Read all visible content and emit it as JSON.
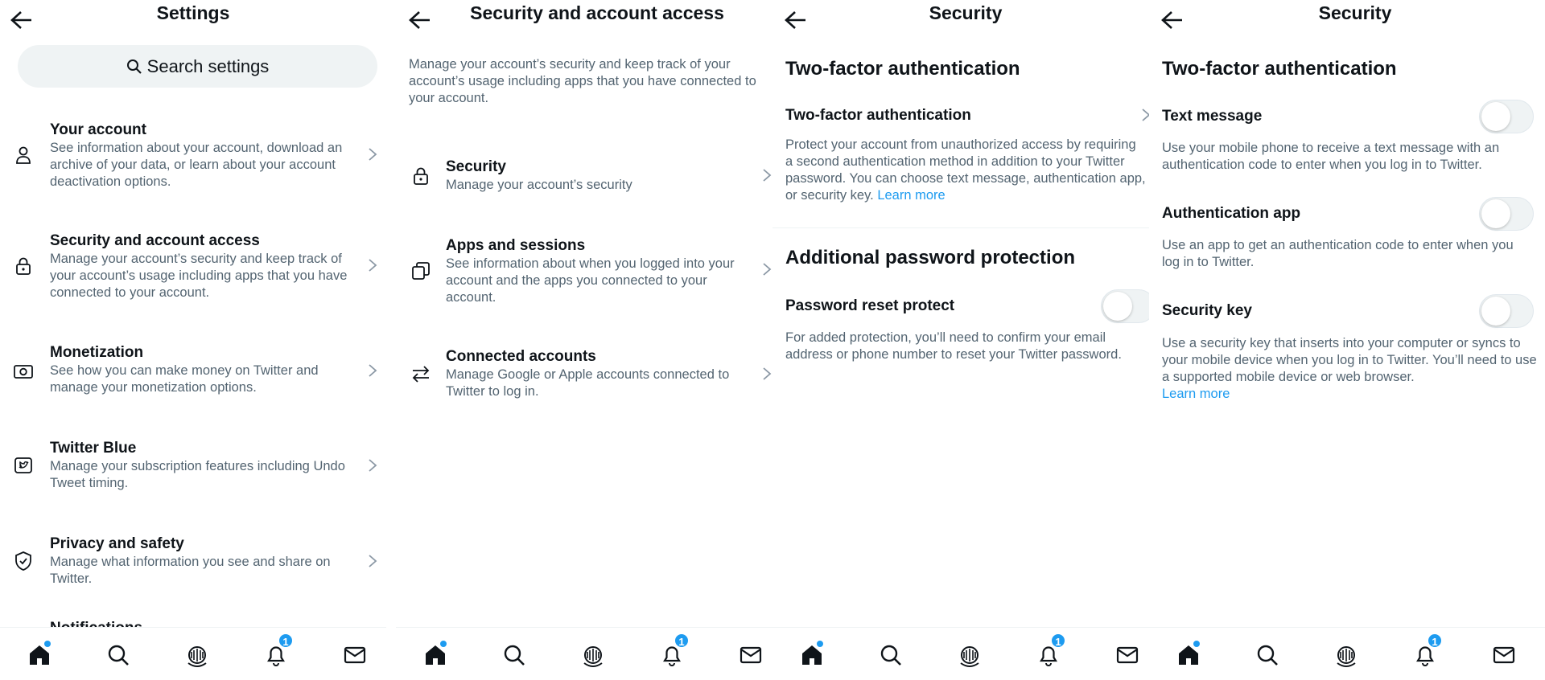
{
  "settings": {
    "title": "Settings",
    "search_placeholder": "Search settings",
    "items": [
      {
        "label": "Your account",
        "desc": "See information about your account, download an archive of your data, or learn about your account deactivation options."
      },
      {
        "label": "Security and account access",
        "desc": "Manage your account’s security and keep track of your account’s usage including apps that you have connected to your account."
      },
      {
        "label": "Monetization",
        "desc": "See how you can make money on Twitter and manage your monetization options."
      },
      {
        "label": "Twitter Blue",
        "desc": "Manage your subscription features including Undo Tweet timing."
      },
      {
        "label": "Privacy and safety",
        "desc": "Manage what information you see and share on Twitter."
      },
      {
        "label": "Notifications",
        "desc": ""
      }
    ]
  },
  "security_access": {
    "title": "Security and account access",
    "intro": "Manage your account’s security and keep track of your account’s usage including apps that you have connected to your account.",
    "items": [
      {
        "label": "Security",
        "desc": "Manage your account’s security"
      },
      {
        "label": "Apps and sessions",
        "desc": "See information about when you logged into your account and the apps you connected to your account."
      },
      {
        "label": "Connected accounts",
        "desc": "Manage Google or Apple accounts connected to Twitter to log in."
      }
    ]
  },
  "security": {
    "title": "Security",
    "tfa_section": "Two-factor authentication",
    "tfa_row": "Two-factor authentication",
    "tfa_desc": "Protect your account from unauthorized access by requiring a second authentication method in addition to your Twitter password. You can choose text message, authentication app, or security key.",
    "learn_more": "Learn more",
    "addl_section": "Additional password protection",
    "reset_row": "Password reset protect",
    "reset_desc": "For added protection, you’ll need to confirm your email address or phone number to reset your Twitter password."
  },
  "security_tfa": {
    "title": "Security",
    "section": "Two-factor authentication",
    "options": [
      {
        "label": "Text message",
        "desc": "Use your mobile phone to receive a text message with an authentication code to enter when you log in to Twitter."
      },
      {
        "label": "Authentication app",
        "desc": "Use an app to get an authentication code to enter when you log in to Twitter."
      },
      {
        "label": "Security key",
        "desc": "Use a security key that inserts into your computer or syncs to your mobile device when you log in to Twitter. You’ll need to use a supported mobile device or web browser."
      }
    ],
    "learn_more": "Learn more"
  },
  "tabbar": {
    "icons": [
      "home-icon",
      "search-icon",
      "spaces-icon",
      "notifications-icon",
      "messages-icon"
    ],
    "notification_count": "1"
  },
  "colors": {
    "accent": "#1d9bf0",
    "text": "#0f1419",
    "secondary": "#536471",
    "surface": "#eff3f4"
  }
}
